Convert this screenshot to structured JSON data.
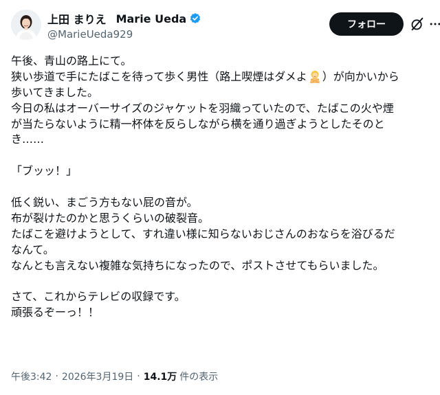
{
  "header": {
    "name_ja": "上田 まりえ",
    "name_en": "Marie Ueda",
    "handle": "@MarieUeda929",
    "follow_label": "フォロー",
    "verified_color": "#1d9bf0",
    "icons": [
      "verified-badge-icon",
      "grok-icon",
      "more-icon"
    ]
  },
  "post": {
    "lines": [
      {
        "text": "午後、青山の路上にて。"
      },
      {
        "text_before": "狭い歩道で手にたばこを待って歩く男性（路上喫煙はダメよ",
        "emoji": "person-gesturing-no-emoji",
        "text_after": "）が向かいから"
      },
      {
        "text": "歩いてきました。"
      },
      {
        "text": "今日の私はオーバーサイズのジャケットを羽織っていたので、たばこの火や煙"
      },
      {
        "text": "が当たらないように精一杯体を反らしながら横を通り過ぎようとしたそのと"
      },
      {
        "text": "き……"
      },
      {
        "text": ""
      },
      {
        "text": "「ブッッ！」"
      },
      {
        "text": ""
      },
      {
        "text": "低く鋭い、まごう方もない屁の音が。"
      },
      {
        "text": "布が裂けたのかと思うくらいの破裂音。"
      },
      {
        "text": "たばこを避けようとして、すれ違い様に知らないおじさんのおならを浴びるだ"
      },
      {
        "text": "なんて。"
      },
      {
        "text": "なんとも言えない複雑な気持ちになったので、ポストさせてもらいました。"
      },
      {
        "text": ""
      },
      {
        "text": "さて、これからテレビの収録です。"
      },
      {
        "text": "頑張るぞーっ！！"
      }
    ]
  },
  "meta": {
    "time": "午後3:42",
    "separator": "·",
    "date": "2026年3月19日",
    "views_count": "14.1万",
    "views_label": "件の表示"
  }
}
